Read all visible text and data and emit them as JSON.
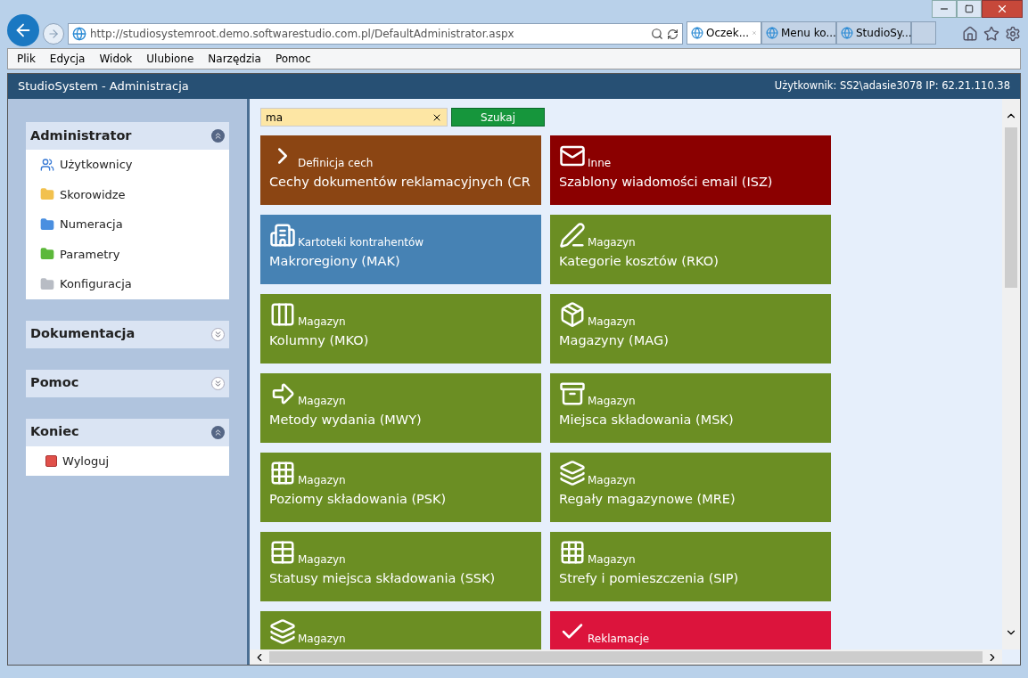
{
  "browser": {
    "address": "http://studiosystemroot.demo.softwarestudio.com.pl/DefaultAdministrator.aspx",
    "tabs": [
      {
        "label": "Oczek...",
        "selected": true
      },
      {
        "label": "Menu ko...",
        "selected": false
      },
      {
        "label": "StudioSy...",
        "selected": false
      }
    ],
    "menu": [
      "Plik",
      "Edycja",
      "Widok",
      "Ulubione",
      "Narzędzia",
      "Pomoc"
    ]
  },
  "app": {
    "title": "StudioSystem - Administracja",
    "user": "Użytkownik: SS2\\adasie3078 IP: 62.21.110.38"
  },
  "sidebar": [
    {
      "title": "Administrator",
      "expanded": true,
      "items": [
        {
          "label": "Użytkownicy",
          "kind": "users"
        },
        {
          "label": "Skorowidze",
          "kind": "folder",
          "color": "#f2c14e"
        },
        {
          "label": "Numeracja",
          "kind": "folder",
          "color": "#4a8fe0"
        },
        {
          "label": "Parametry",
          "kind": "folder",
          "color": "#5cb83a"
        },
        {
          "label": "Konfiguracja",
          "kind": "folder",
          "color": "#b8bcc4"
        }
      ]
    },
    {
      "title": "Dokumentacja",
      "expanded": false
    },
    {
      "title": "Pomoc",
      "expanded": false
    },
    {
      "title": "Koniec",
      "expanded": true,
      "items": [
        {
          "label": "Wyloguj",
          "kind": "logout",
          "color": "#e0504a"
        }
      ]
    }
  ],
  "search": {
    "value": "ma",
    "button": "Szukaj"
  },
  "tiles": [
    {
      "category": "Definicja cech",
      "title": "Cechy dokumentów reklamacyjnych (CR",
      "color": "#8b4513"
    },
    {
      "category": "Inne",
      "title": "Szablony wiadomości email (ISZ)",
      "color": "#8b0000"
    },
    {
      "category": "Kartoteki kontrahentów",
      "title": "Makroregiony (MAK)",
      "color": "#4682b4"
    },
    {
      "category": "Magazyn",
      "title": "Kategorie kosztów (RKO)",
      "color": "#6b8e23"
    },
    {
      "category": "Magazyn",
      "title": "Kolumny (MKO)",
      "color": "#6b8e23"
    },
    {
      "category": "Magazyn",
      "title": "Magazyny (MAG)",
      "color": "#6b8e23"
    },
    {
      "category": "Magazyn",
      "title": "Metody wydania (MWY)",
      "color": "#6b8e23"
    },
    {
      "category": "Magazyn",
      "title": "Miejsca składowania (MSK)",
      "color": "#6b8e23"
    },
    {
      "category": "Magazyn",
      "title": "Poziomy składowania (PSK)",
      "color": "#6b8e23"
    },
    {
      "category": "Magazyn",
      "title": "Regały magazynowe (MRE)",
      "color": "#6b8e23"
    },
    {
      "category": "Magazyn",
      "title": "Statusy miejsca składowania (SSK)",
      "color": "#6b8e23"
    },
    {
      "category": "Magazyn",
      "title": "Strefy i pomieszczenia (SIP)",
      "color": "#6b8e23"
    },
    {
      "category": "Magazyn",
      "color": "#6b8e23"
    },
    {
      "category": "Reklamacje",
      "color": "#dc143c"
    }
  ]
}
